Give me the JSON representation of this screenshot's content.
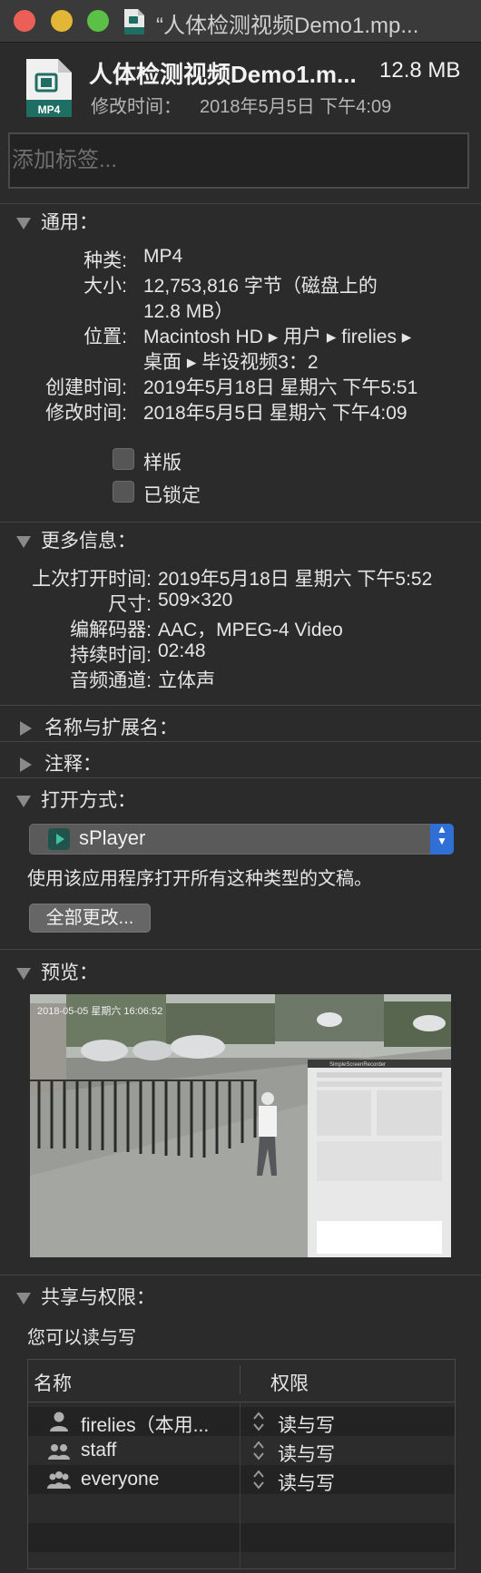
{
  "window": {
    "title": "“人体检测视频Demo1.mp..."
  },
  "header": {
    "file_name": "人体检测视频Demo1.m...",
    "file_size": "12.8 MB",
    "modified_label": "修改时间：",
    "modified_value": "2018年5月5日 下午4:09",
    "icon_label": "MP4"
  },
  "tags": {
    "placeholder": "添加标签..."
  },
  "general": {
    "title": "通用：",
    "kind_label": "种类:",
    "kind_value": "MP4",
    "size_label": "大小:",
    "size_value_line1": "12,753,816 字节（磁盘上的",
    "size_value_line2": "12.8 MB）",
    "where_label": "位置:",
    "where_value_line1": "Macintosh HD ▸ 用户 ▸ firelies ▸",
    "where_value_line2": "桌面 ▸ 毕设视频3：2",
    "created_label": "创建时间:",
    "created_value": "2019年5月18日 星期六 下午5:51",
    "modified_label": "修改时间:",
    "modified_value": "2018年5月5日 星期六 下午4:09",
    "stationery_label": "样版",
    "locked_label": "已锁定"
  },
  "more_info": {
    "title": "更多信息：",
    "last_opened_label": "上次打开时间:",
    "last_opened_value": "2019年5月18日 星期六 下午5:52",
    "dimensions_label": "尺寸:",
    "dimensions_value": "509×320",
    "codecs_label": "编解码器:",
    "codecs_value": "AAC，MPEG-4 Video",
    "duration_label": "持续时间:",
    "duration_value": "02:48",
    "audio_label": "音频通道:",
    "audio_value": "立体声"
  },
  "name_ext": {
    "title": "名称与扩展名："
  },
  "comments": {
    "title": "注释："
  },
  "open_with": {
    "title": "打开方式：",
    "app_name": "sPlayer",
    "description": "使用该应用程序打开所有这种类型的文稿。",
    "change_all_label": "全部更改..."
  },
  "preview": {
    "title": "预览：",
    "overlay_timestamp": "2018-05-05 星期六 16:06:52",
    "overlay_window_title": "SimpleScreenRecorder"
  },
  "sharing": {
    "title": "共享与权限：",
    "summary": "您可以读与写",
    "col_name": "名称",
    "col_privilege": "权限",
    "rows": [
      {
        "name": "firelies（本用...",
        "privilege": "读与写",
        "icon": "user-icon"
      },
      {
        "name": "staff",
        "privilege": "读与写",
        "icon": "group-icon"
      },
      {
        "name": "everyone",
        "privilege": "读与写",
        "icon": "everyone-icon"
      }
    ]
  },
  "colors": {
    "background": "#2b2b2b",
    "accent": "#2f6fd6",
    "close": "#ec5f57",
    "minimize": "#e3b735",
    "zoom": "#5ac046"
  }
}
